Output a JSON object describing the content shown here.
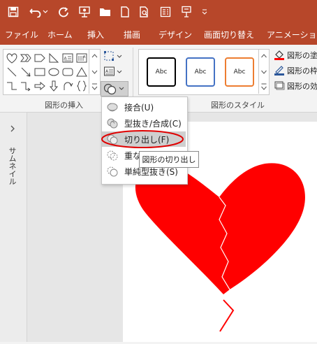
{
  "qat": {
    "icons": [
      "save-icon",
      "undo-icon",
      "undo-dropdown-icon",
      "redo-icon",
      "presenter-icon",
      "open-icon",
      "new-icon",
      "print-preview-icon",
      "slides-icon",
      "touch-mode-icon",
      "customize-qat-icon"
    ]
  },
  "tabs": [
    "ファイル",
    "ホーム",
    "挿入",
    "描画",
    "デザイン",
    "画面切り替え",
    "アニメーション"
  ],
  "ribbon": {
    "insert_shapes_label": "図形の挿入",
    "shape_styles_label": "図形のスタイル",
    "style_sample_text": "Abc",
    "style_border_colors": [
      "#000000",
      "#4472c4",
      "#ed7d31"
    ],
    "format_fill_label": "図形の塗",
    "format_outline_label": "図形の枠",
    "format_effects_label": "図形の効"
  },
  "sidebar": {
    "thumbnail_label": "サムネイル",
    "expand_icon": "chevron-right-icon"
  },
  "merge_menu": {
    "items": [
      {
        "label": "接合(U)",
        "icon": "union-icon"
      },
      {
        "label": "型抜き/合成(C)",
        "icon": "combine-icon"
      },
      {
        "label": "切り出し(F)",
        "icon": "fragment-icon",
        "active": true
      },
      {
        "label": "重な",
        "icon": "intersect-icon"
      },
      {
        "label": "単純型抜き(S)",
        "icon": "subtract-icon"
      }
    ],
    "tooltip": "図形の切り出し"
  },
  "colors": {
    "accent": "#b7472a",
    "heart": "#ff0000",
    "highlight_ellipse": "#e00000"
  }
}
